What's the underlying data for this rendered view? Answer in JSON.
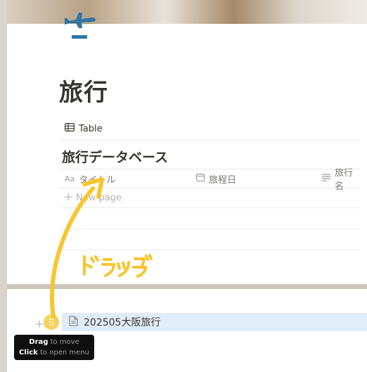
{
  "page": {
    "title": "旅行",
    "icon": "airplane-icon"
  },
  "view_tab": {
    "label": "Table",
    "icon": "table-icon"
  },
  "database": {
    "title": "旅行データベース",
    "columns": [
      {
        "type_glyph": "Aa",
        "label": "タイトル",
        "icon": "title-property-icon"
      },
      {
        "label": "旅程日",
        "icon": "calendar-icon"
      },
      {
        "label": "旅行名",
        "icon": "text-lines-icon"
      }
    ],
    "new_page_label": "New page"
  },
  "annotation": {
    "label": "ドラッグ",
    "arrow_color": "#f7c62f"
  },
  "dragged_page": {
    "title": "202505大阪旅行",
    "icon": "document-icon"
  },
  "tooltip": {
    "line1_bold": "Drag",
    "line1_rest": " to move",
    "line2_bold": "Click",
    "line2_rest": " to open menu"
  },
  "colors": {
    "selection": "#e0ecf8",
    "highlight_yellow": "#f7c62f",
    "airplane_blue": "#2f75a6"
  }
}
